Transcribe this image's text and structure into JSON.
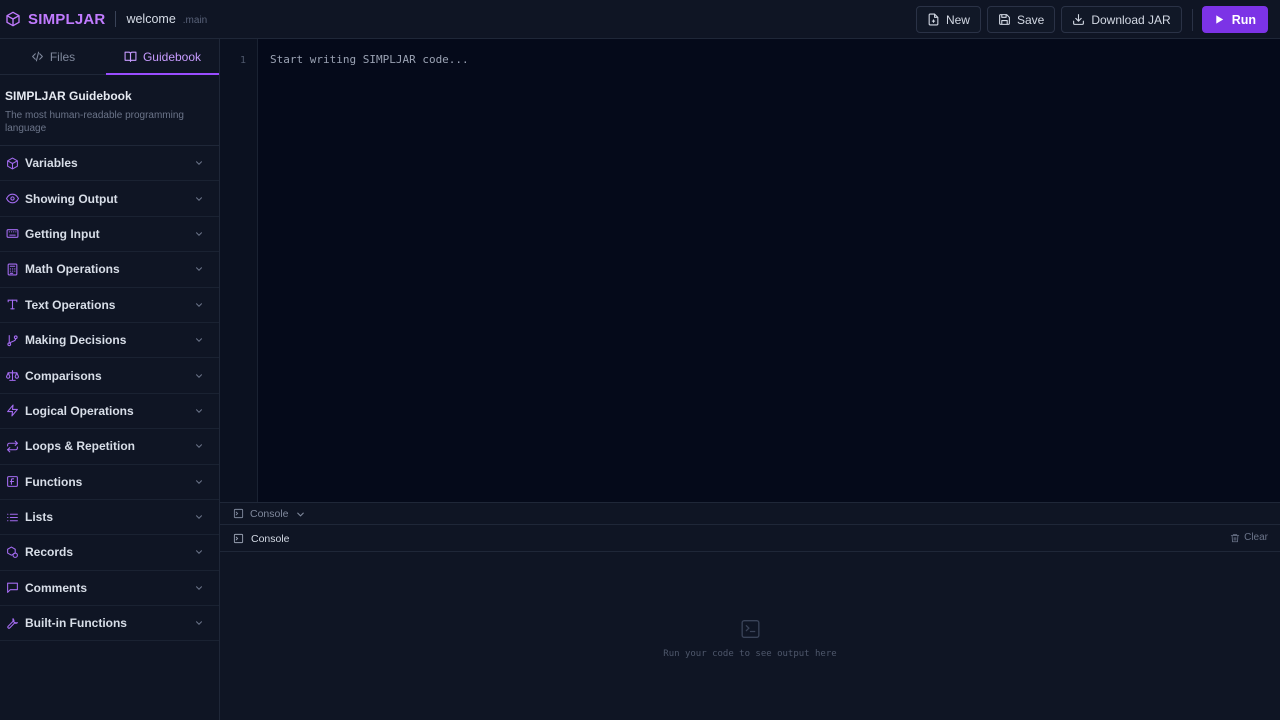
{
  "header": {
    "brand": "SIMPLJAR",
    "file_name": "welcome",
    "branch": ".main",
    "actions": {
      "new_label": "New",
      "save_label": "Save",
      "download_label": "Download JAR",
      "run_label": "Run"
    }
  },
  "sidebar": {
    "tabs": [
      {
        "label": "Files",
        "icon": "code-icon"
      },
      {
        "label": "Guidebook",
        "icon": "book-icon"
      }
    ],
    "active_tab": "Guidebook",
    "guide": {
      "title": "SIMPLJAR Guidebook",
      "subtitle": "The most human-readable programming language"
    },
    "topics": [
      {
        "label": "Variables",
        "icon": "box-icon"
      },
      {
        "label": "Showing Output",
        "icon": "eye-icon"
      },
      {
        "label": "Getting Input",
        "icon": "keyboard-icon"
      },
      {
        "label": "Math Operations",
        "icon": "calculator-icon"
      },
      {
        "label": "Text Operations",
        "icon": "type-icon"
      },
      {
        "label": "Making Decisions",
        "icon": "branch-icon"
      },
      {
        "label": "Comparisons",
        "icon": "scale-icon"
      },
      {
        "label": "Logical Operations",
        "icon": "zap-icon"
      },
      {
        "label": "Loops & Repetition",
        "icon": "repeat-icon"
      },
      {
        "label": "Functions",
        "icon": "function-icon"
      },
      {
        "label": "Lists",
        "icon": "list-icon"
      },
      {
        "label": "Records",
        "icon": "records-icon"
      },
      {
        "label": "Comments",
        "icon": "comment-icon"
      },
      {
        "label": "Built-in Functions",
        "icon": "wrench-icon"
      }
    ]
  },
  "editor": {
    "line_number": "1",
    "placeholder": "Start writing SIMPLJAR code..."
  },
  "console": {
    "panel_label": "Console",
    "title": "Console",
    "clear_label": "Clear",
    "empty_message": "Run your code to see output here"
  },
  "colors": {
    "accent": "#9a4dff",
    "run_button": "#7c33e6",
    "brand": "#c17bff"
  }
}
